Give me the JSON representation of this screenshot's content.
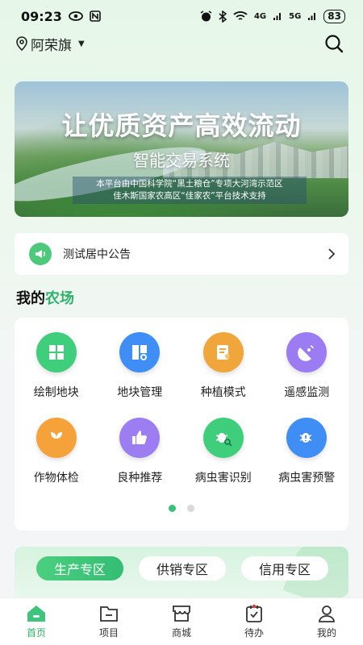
{
  "status_bar": {
    "time": "09:23",
    "signal1": "4G",
    "signal2": "5G",
    "battery": "83"
  },
  "header": {
    "location": "阿荣旗"
  },
  "banner": {
    "headline": "让优质资产高效流动",
    "subline": "智能交易系统",
    "desc_line1": "本平台由中国科学院“黑土粮仓”专项大河湾示范区",
    "desc_line2": "佳木斯国家农高区“佳家农”平台技术支持"
  },
  "notice": {
    "text": "测试居中公告"
  },
  "section": {
    "title_prefix": "我的",
    "title_accent": "农场"
  },
  "farm_tools": [
    {
      "label": "绘制地块",
      "icon": "map-block-icon",
      "color": "#3fcf7c"
    },
    {
      "label": "地块管理",
      "icon": "plot-manage-icon",
      "color": "#3f8ef5"
    },
    {
      "label": "种植模式",
      "icon": "planting-mode-icon",
      "color": "#f0a63a"
    },
    {
      "label": "遥感监测",
      "icon": "satellite-icon",
      "color": "#9b7cf2"
    },
    {
      "label": "作物体检",
      "icon": "crop-check-icon",
      "color": "#f6a23a"
    },
    {
      "label": "良种推荐",
      "icon": "thumbs-up-icon",
      "color": "#9d7df2"
    },
    {
      "label": "病虫害识别",
      "icon": "bug-search-icon",
      "color": "#3fcf7c"
    },
    {
      "label": "病虫害预警",
      "icon": "bug-alert-icon",
      "color": "#3f8ef5"
    }
  ],
  "zones": [
    "生产专区",
    "供销专区",
    "信用专区"
  ],
  "bottom_nav": [
    {
      "label": "首页",
      "icon": "home-icon"
    },
    {
      "label": "项目",
      "icon": "folder-icon"
    },
    {
      "label": "商城",
      "icon": "store-icon"
    },
    {
      "label": "待办",
      "icon": "todo-icon"
    },
    {
      "label": "我的",
      "icon": "user-icon"
    }
  ],
  "colors": {
    "accent": "#2db36a"
  }
}
